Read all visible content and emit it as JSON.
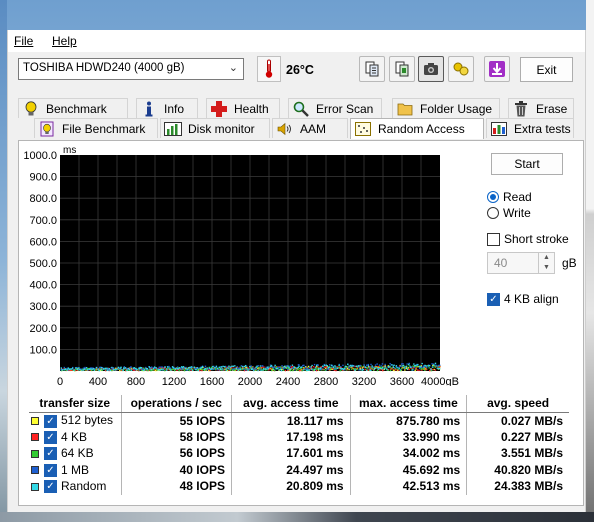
{
  "menu": {
    "file": "File",
    "help": "Help"
  },
  "toolbar": {
    "drive": "TOSHIBA HDWD240 (4000 gB)",
    "temperature": "26°C",
    "exit_label": "Exit",
    "icons": [
      "copy-text-icon",
      "copy-html-icon",
      "screenshot-icon",
      "compare-icon",
      "save-icon"
    ]
  },
  "tabs_top": [
    {
      "label": "Benchmark",
      "icon": "bulb-icon"
    },
    {
      "label": "Info",
      "icon": "info-icon"
    },
    {
      "label": "Health",
      "icon": "health-cross-icon"
    },
    {
      "label": "Error Scan",
      "icon": "magnifier-icon"
    },
    {
      "label": "Folder Usage",
      "icon": "folder-icon"
    },
    {
      "label": "Erase",
      "icon": "trash-icon"
    }
  ],
  "tabs_bottom": [
    {
      "label": "File Benchmark",
      "icon": "file-bulb-icon"
    },
    {
      "label": "Disk monitor",
      "icon": "monitor-chart-icon"
    },
    {
      "label": "AAM",
      "icon": "speaker-icon"
    },
    {
      "label": "Random Access",
      "icon": "random-access-icon",
      "active": true
    },
    {
      "label": "Extra tests",
      "icon": "extra-tests-icon"
    }
  ],
  "chart": {
    "y_unit": "ms",
    "y_ticks": [
      "1000.0",
      "900.0",
      "800.0",
      "700.0",
      "600.0",
      "500.0",
      "400.0",
      "300.0",
      "200.0",
      "100.0"
    ],
    "x_ticks": [
      "0",
      "400",
      "800",
      "1200",
      "1600",
      "2000",
      "2400",
      "2800",
      "3200",
      "3600",
      "4000gB"
    ]
  },
  "chart_data": {
    "type": "scatter",
    "xlabel": "",
    "ylabel": "ms",
    "xlim": [
      0,
      4000
    ],
    "ylim": [
      0,
      1000
    ],
    "x_unit": "gB",
    "series": [
      {
        "name": "512 bytes",
        "color": "#ffff33",
        "y_range": [
          5,
          30
        ]
      },
      {
        "name": "4 KB",
        "color": "#ff2222",
        "y_range": [
          5,
          30
        ]
      },
      {
        "name": "64 KB",
        "color": "#33cc33",
        "y_range": [
          5,
          30
        ]
      },
      {
        "name": "1 MB",
        "color": "#1f5fd0",
        "y_range": [
          8,
          40
        ]
      },
      {
        "name": "Random",
        "color": "#33d9e6",
        "y_range": [
          5,
          40
        ]
      }
    ]
  },
  "controls": {
    "start_label": "Start",
    "read_label": "Read",
    "write_label": "Write",
    "short_stroke_label": "Short stroke",
    "stroke_value": "40",
    "stroke_unit": "gB",
    "align_label": "4 KB align"
  },
  "results": {
    "headers": [
      "transfer size",
      "operations / sec",
      "avg. access time",
      "max. access time",
      "avg. speed"
    ],
    "rows": [
      {
        "name": "512 bytes",
        "color": "#ffff33",
        "ops": "55 IOPS",
        "avg": "18.117 ms",
        "max": "875.780 ms",
        "speed": "0.027 MB/s"
      },
      {
        "name": "4 KB",
        "color": "#ff2222",
        "ops": "58 IOPS",
        "avg": "17.198 ms",
        "max": "33.990 ms",
        "speed": "0.227 MB/s"
      },
      {
        "name": "64 KB",
        "color": "#33cc33",
        "ops": "56 IOPS",
        "avg": "17.601 ms",
        "max": "34.002 ms",
        "speed": "3.551 MB/s"
      },
      {
        "name": "1 MB",
        "color": "#1f5fd0",
        "ops": "40 IOPS",
        "avg": "24.497 ms",
        "max": "45.692 ms",
        "speed": "40.820 MB/s"
      },
      {
        "name": "Random",
        "color": "#33d9e6",
        "ops": "48 IOPS",
        "avg": "20.809 ms",
        "max": "42.513 ms",
        "speed": "24.383 MB/s"
      }
    ]
  }
}
